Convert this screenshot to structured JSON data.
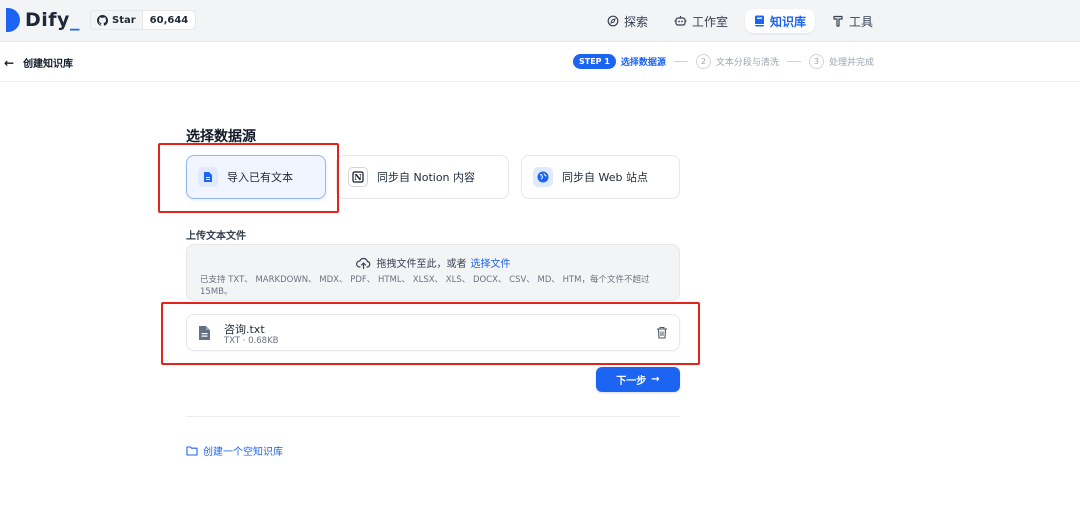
{
  "header": {
    "logo_text": "Dify",
    "github": {
      "star_label": "Star",
      "count": "60,644"
    },
    "nav": [
      {
        "label": "探索",
        "icon": "compass-icon",
        "active": false
      },
      {
        "label": "工作室",
        "icon": "robot-icon",
        "active": false
      },
      {
        "label": "知识库",
        "icon": "book-icon",
        "active": true
      },
      {
        "label": "工具",
        "icon": "hammer-icon",
        "active": false
      }
    ]
  },
  "subheader": {
    "back_label": "创建知识库",
    "steps": [
      {
        "badge": "STEP 1",
        "label": "选择数据源",
        "active": true
      },
      {
        "num": "2",
        "label": "文本分段与清洗",
        "active": false
      },
      {
        "num": "3",
        "label": "处理并完成",
        "active": false
      }
    ]
  },
  "main": {
    "section_title": "选择数据源",
    "sources": [
      {
        "label": "导入已有文本",
        "selected": true
      },
      {
        "label": "同步自 Notion 内容",
        "selected": false
      },
      {
        "label": "同步自 Web 站点",
        "selected": false
      }
    ],
    "upload": {
      "label": "上传文本文件",
      "drop_text": "拖拽文件至此，或者",
      "select_link": "选择文件",
      "hint": "已支持 TXT、 MARKDOWN、 MDX、 PDF、 HTML、 XLSX、 XLS、 DOCX、 CSV、 MD、 HTM，每个文件不超过 15MB。"
    },
    "file": {
      "name": "咨询.txt",
      "meta": "TXT · 0.68KB"
    },
    "next_button": "下一步",
    "empty_kb_link": "创建一个空知识库"
  },
  "colors": {
    "primary": "#1c64f2",
    "highlight_box": "#e1251b"
  }
}
